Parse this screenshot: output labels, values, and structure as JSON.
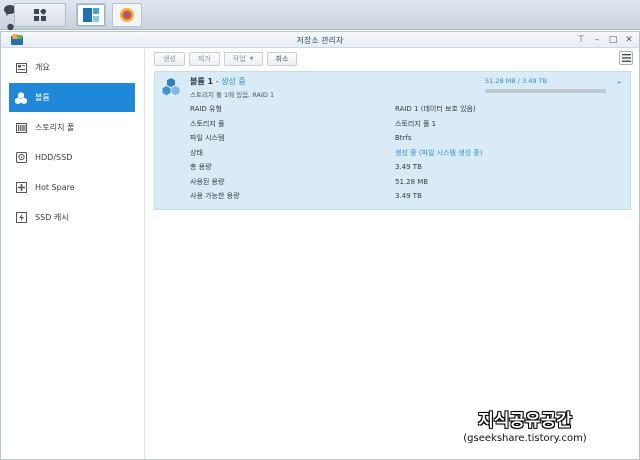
{
  "window": {
    "title": "저장소 관리자",
    "controls": [
      "pin-icon",
      "minimize-icon",
      "maximize-icon",
      "close-icon"
    ]
  },
  "sidebar": {
    "items": [
      {
        "label": "개요",
        "icon": "overview-icon",
        "active": false
      },
      {
        "label": "볼륨",
        "icon": "volume-icon",
        "active": true
      },
      {
        "label": "스토리지 풀",
        "icon": "storage-pool-icon",
        "active": false
      },
      {
        "label": "HDD/SSD",
        "icon": "hdd-icon",
        "active": false
      },
      {
        "label": "Hot Spare",
        "icon": "hot-spare-icon",
        "active": false
      },
      {
        "label": "SSD 캐시",
        "icon": "ssd-cache-icon",
        "active": false
      }
    ]
  },
  "toolbar": {
    "create_label": "생성",
    "remove_label": "제거",
    "action_label": "작업",
    "cancel_label": "취소"
  },
  "volume": {
    "name": "볼륨 1",
    "separator": " - ",
    "status": "생성 중",
    "subtitle": "스토리지 풀 1에 있음, RAID 1",
    "usage_text": "51.28 MB / 3.49 TB",
    "usage_fraction": 0.0,
    "details": [
      {
        "key": "RAID 유형",
        "value": "RAID 1 (데이터 보호 있음)",
        "link": false
      },
      {
        "key": "스토리지 풀",
        "value": "스토리지 풀 1",
        "link": false
      },
      {
        "key": "파일 시스템",
        "value": "Btrfs",
        "link": false
      },
      {
        "key": "상태",
        "value": "생성 중 (파일 시스템 생성 중)",
        "link": true
      },
      {
        "key": "총 용량",
        "value": "3.49 TB",
        "link": false
      },
      {
        "key": "사용된 용량",
        "value": "51.28 MB",
        "link": false
      },
      {
        "key": "사용 가능한 용량",
        "value": "3.49 TB",
        "link": false
      }
    ]
  },
  "watermark": {
    "line1": "지식공유공간",
    "line2": "(gseekshare.tistory.com)"
  },
  "colors": {
    "accent": "#1f88d8",
    "link": "#2f8fd6",
    "panel_bg": "#d9ebf7"
  }
}
